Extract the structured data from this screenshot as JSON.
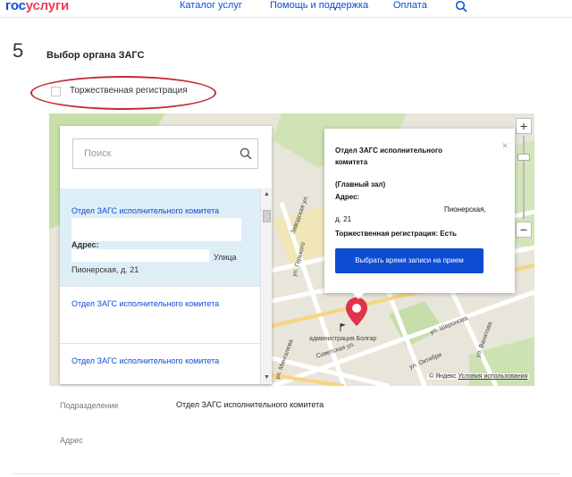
{
  "header": {
    "logo_part1": "гос",
    "logo_part2": "услуги",
    "nav": [
      "Каталог услуг",
      "Помощь и поддержка",
      "Оплата"
    ],
    "search_icon": "search-icon"
  },
  "step": {
    "number": "5",
    "title": "Выбор органа ЗАГС"
  },
  "ceremony_checkbox": {
    "label": "Торжественная регистрация",
    "checked": false
  },
  "list": {
    "search_placeholder": "Поиск",
    "items": [
      {
        "title": "Отдел ЗАГС исполнительного комитета",
        "address_label": "Адрес:",
        "address_tail": "Улица",
        "address_line2": "Пионерская, д. 21",
        "selected": true
      },
      {
        "title": "Отдел ЗАГС исполнительного комитета",
        "selected": false
      },
      {
        "title": "Отдел ЗАГС исполнительного комитета",
        "selected": false
      }
    ]
  },
  "balloon": {
    "title_line1": "Отдел ЗАГС исполнительного",
    "title_line2": "комитета",
    "hall": "(Главный зал)",
    "address_label": "Адрес:",
    "address_street": "Пионерская,",
    "address_house": "д. 21",
    "ceremony_label": "Торжественная регистрация:",
    "ceremony_value": "Есть",
    "button": "Выбрать время записи на прием"
  },
  "map": {
    "zoom_in": "+",
    "zoom_out": "−",
    "labels": {
      "admin": "администрация Болгар",
      "sovetskaya": "Советская ул.",
      "oktyabrya": "ул. Октября",
      "sheronova": "ул. Шеронова",
      "gorkogo": "ул. Горького",
      "mingaleva": "ул. Мингалева",
      "vakhitova": "ул. Вахитова",
      "zavodskaya": "Заводская ул."
    },
    "copyright_prefix": "© Яндекс",
    "terms_link": "Условия использования"
  },
  "details": {
    "department_label": "Подразделение",
    "department_value": "Отдел ЗАГС исполнительного комитета",
    "address_label": "Адрес"
  }
}
